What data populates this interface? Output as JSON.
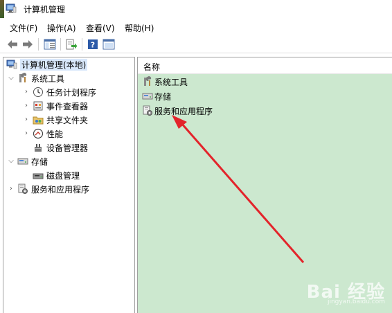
{
  "window": {
    "title": "计算机管理"
  },
  "menubar": {
    "items": [
      {
        "label": "文件(F)"
      },
      {
        "label": "操作(A)"
      },
      {
        "label": "查看(V)"
      },
      {
        "label": "帮助(H)"
      }
    ]
  },
  "toolbar": {
    "buttons": [
      "back-icon",
      "forward-icon",
      "show-console-tree-icon",
      "export-icon",
      "help-icon",
      "properties-icon"
    ]
  },
  "tree": {
    "root": {
      "label": "计算机管理(本地)"
    },
    "system_tools": {
      "label": "系统工具"
    },
    "task_scheduler": {
      "label": "任务计划程序"
    },
    "event_viewer": {
      "label": "事件查看器"
    },
    "shared_folders": {
      "label": "共享文件夹"
    },
    "performance": {
      "label": "性能"
    },
    "device_manager": {
      "label": "设备管理器"
    },
    "storage": {
      "label": "存储"
    },
    "disk_management": {
      "label": "磁盘管理"
    },
    "services_apps": {
      "label": "服务和应用程序"
    }
  },
  "content": {
    "column_header": "名称",
    "items": [
      {
        "label": "系统工具"
      },
      {
        "label": "存储"
      },
      {
        "label": "服务和应用程序"
      }
    ]
  },
  "colors": {
    "content_bg": "#cce8cf",
    "annotation_arrow": "#e3242b",
    "selection": "#d9e8fb"
  },
  "watermark": {
    "main": "Bai 经验",
    "sub": "jingyan.baidu.com"
  }
}
